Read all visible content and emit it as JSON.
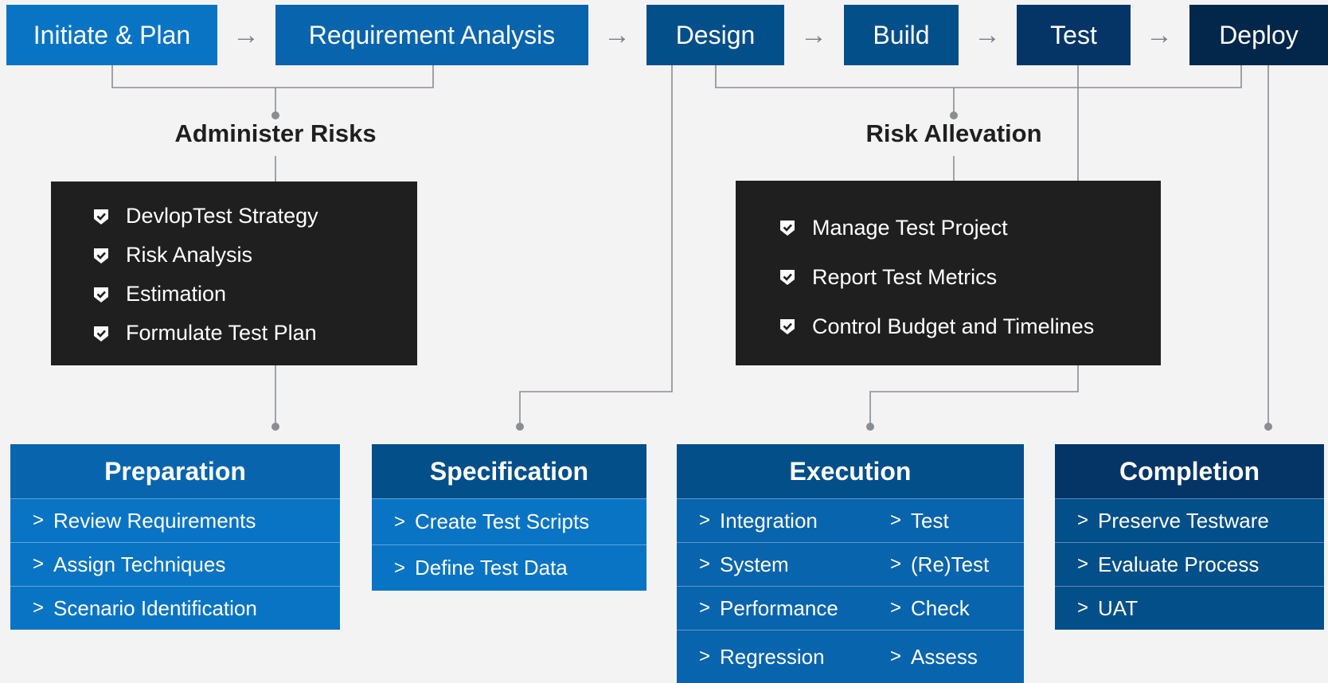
{
  "colors": {
    "background": "#f3f3f4",
    "blue_light": "#0a74c4",
    "blue_mid": "#0864ad",
    "blue_dark": "#034f89",
    "navy": "#053566",
    "navy_darkest": "#03274b",
    "dark_box": "#1f1f1f",
    "connector": "#8a8d91"
  },
  "stages": [
    {
      "label": "Initiate & Plan"
    },
    {
      "label": "Requirement Analysis"
    },
    {
      "label": "Design"
    },
    {
      "label": "Build"
    },
    {
      "label": "Test"
    },
    {
      "label": "Deploy"
    }
  ],
  "arrow_glyph": "→",
  "administer_risks": {
    "heading": "Administer Risks",
    "items": [
      "DevlopTest Strategy",
      "Risk Analysis",
      "Estimation",
      "Formulate Test Plan"
    ],
    "icon": "shield-check-icon"
  },
  "risk_allevation": {
    "heading": "Risk Allevation",
    "items": [
      "Manage Test Project",
      "Report Test Metrics",
      "Control Budget and Timelines"
    ],
    "icon": "shield-check-icon"
  },
  "chevron_glyph": ">",
  "cards": {
    "preparation": {
      "title": "Preparation",
      "items": [
        "Review Requirements",
        "Assign Techniques",
        "Scenario Identification"
      ]
    },
    "specification": {
      "title": "Specification",
      "items": [
        "Create Test Scripts",
        "Define Test Data"
      ]
    },
    "execution": {
      "title": "Execution",
      "rows": [
        [
          "Integration",
          "Test"
        ],
        [
          "System",
          "(Re)Test"
        ],
        [
          "Performance",
          "Check"
        ],
        [
          "Regression",
          "Assess"
        ]
      ]
    },
    "completion": {
      "title": "Completion",
      "items": [
        "Preserve Testware",
        "Evaluate Process",
        "UAT"
      ]
    }
  }
}
